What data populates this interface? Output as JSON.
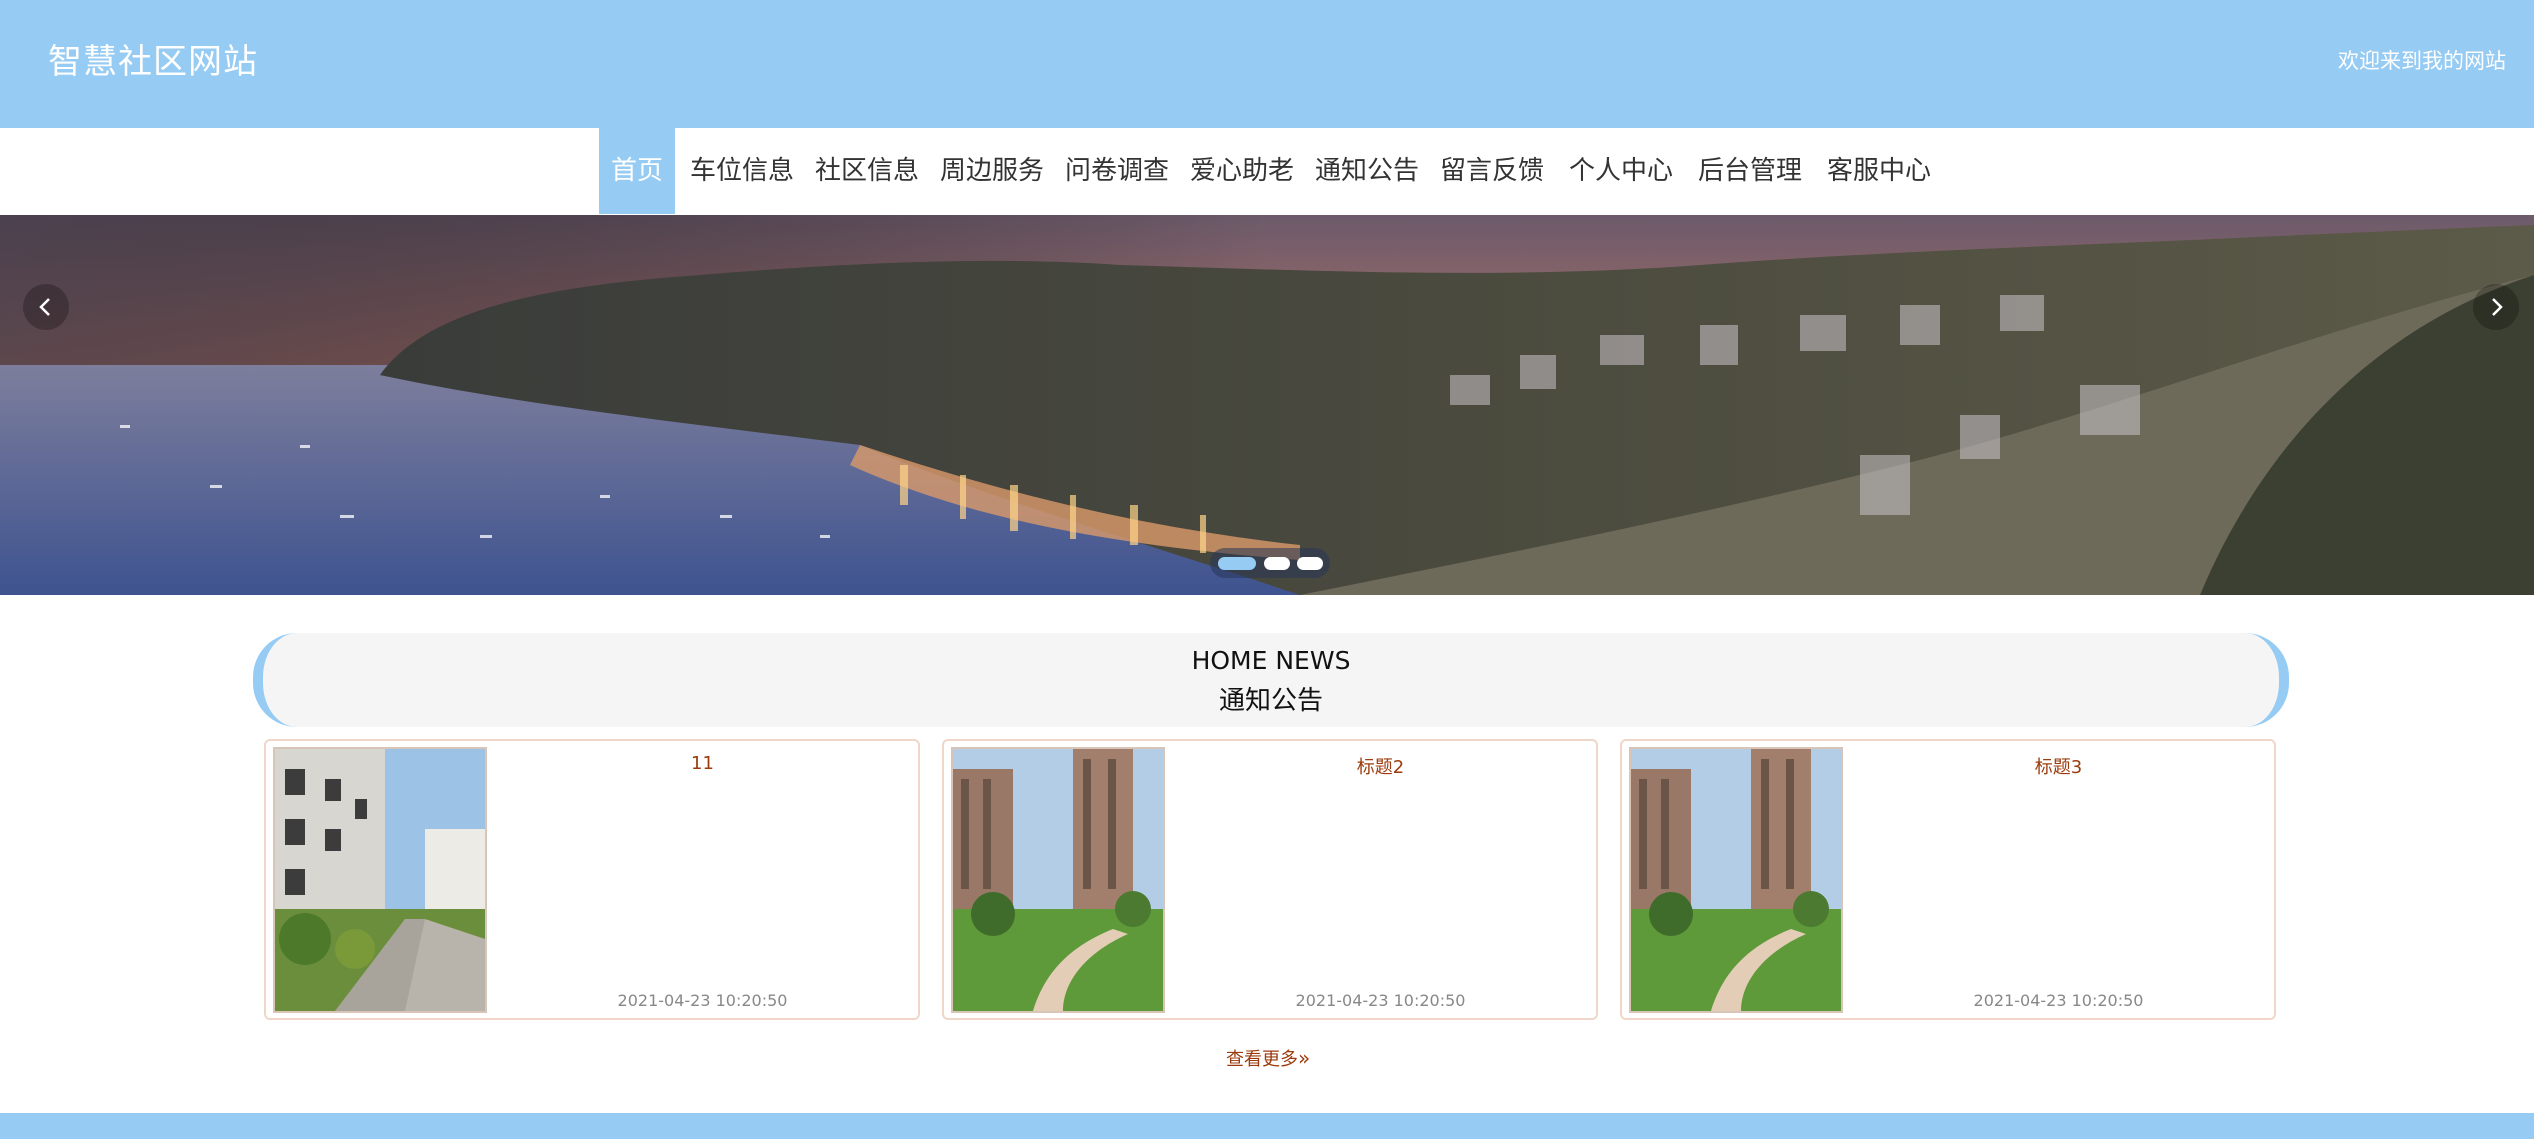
{
  "header": {
    "site_title": "智慧社区网站",
    "welcome": "欢迎来到我的网站"
  },
  "nav": {
    "items": [
      {
        "label": "首页",
        "active": true
      },
      {
        "label": "车位信息"
      },
      {
        "label": "社区信息"
      },
      {
        "label": "周边服务"
      },
      {
        "label": "问卷调查"
      },
      {
        "label": "爱心助老"
      },
      {
        "label": "通知公告"
      },
      {
        "label": "留言反馈"
      },
      {
        "label": "个人中心"
      },
      {
        "label": "后台管理"
      },
      {
        "label": "客服中心"
      }
    ]
  },
  "carousel": {
    "slide_count": 3,
    "active_index": 0,
    "prev_icon": "chevron-left-icon",
    "next_icon": "chevron-right-icon"
  },
  "news": {
    "title_en": "HOME NEWS",
    "title_cn": "通知公告",
    "items": [
      {
        "title": "11",
        "time": "2021-04-23 10:20:50",
        "image": "apartment-street-photo"
      },
      {
        "title": "标题2",
        "time": "2021-04-23 10:20:50",
        "image": "residential-towers-photo"
      },
      {
        "title": "标题3",
        "time": "2021-04-23 10:20:50",
        "image": "residential-towers-photo"
      }
    ],
    "more_label": "查看更多",
    "more_icon": "double-chevron-right-icon"
  },
  "colors": {
    "accent": "#96cbf3",
    "link": "#9b3b0e",
    "card_border": "#f0d6c8"
  }
}
